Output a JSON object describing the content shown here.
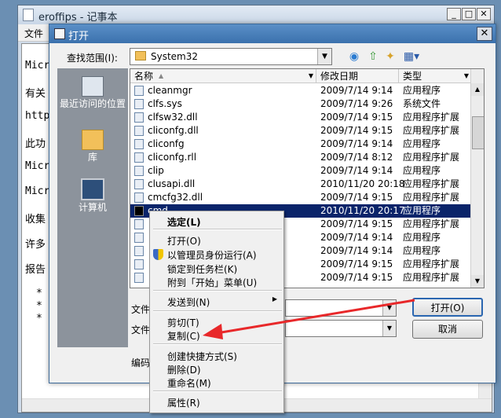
{
  "notepad": {
    "title": "eroffips - 记事本",
    "menu_file": "文件",
    "lines": [
      "Micr",
      "有关",
      "http",
      "此功",
      "Micr",
      "Micr",
      "收集",
      "许多",
      "报告",
      "*",
      "*",
      "*"
    ]
  },
  "dialog": {
    "title": "打开",
    "look_in_label": "查找范围(I):",
    "look_in_value": "System32",
    "places": [
      {
        "label": "最近访问的位置",
        "icon": "recent-places-icon"
      },
      {
        "label": "库",
        "icon": "libraries-icon"
      },
      {
        "label": "计算机",
        "icon": "computer-icon"
      }
    ],
    "columns": {
      "name": "名称",
      "date": "修改日期",
      "type": "类型"
    },
    "files": [
      {
        "name": "cleanmgr",
        "date": "2009/7/14 9:14",
        "type": "应用程序"
      },
      {
        "name": "clfs.sys",
        "date": "2009/7/14 9:26",
        "type": "系统文件"
      },
      {
        "name": "clfsw32.dll",
        "date": "2009/7/14 9:15",
        "type": "应用程序扩展"
      },
      {
        "name": "cliconfg.dll",
        "date": "2009/7/14 9:15",
        "type": "应用程序扩展"
      },
      {
        "name": "cliconfg",
        "date": "2009/7/14 9:14",
        "type": "应用程序"
      },
      {
        "name": "cliconfg.rll",
        "date": "2009/7/14 8:12",
        "type": "应用程序扩展"
      },
      {
        "name": "clip",
        "date": "2009/7/14 9:14",
        "type": "应用程序"
      },
      {
        "name": "clusapi.dll",
        "date": "2010/11/20 20:18",
        "type": "应用程序扩展"
      },
      {
        "name": "cmcfg32.dll",
        "date": "2009/7/14 9:15",
        "type": "应用程序扩展"
      },
      {
        "name": "cmd",
        "date": "2010/11/20 20:17",
        "type": "应用程序"
      },
      {
        "name": "",
        "date": "2009/7/14 9:15",
        "type": "应用程序扩展"
      },
      {
        "name": "",
        "date": "2009/7/14 9:14",
        "type": "应用程序"
      },
      {
        "name": "",
        "date": "2009/7/14 9:14",
        "type": "应用程序"
      },
      {
        "name": "",
        "date": "2009/7/14 9:15",
        "type": "应用程序扩展"
      },
      {
        "name": "",
        "date": "2009/7/14 9:15",
        "type": "应用程序扩展"
      }
    ],
    "filename_label": "文件",
    "filetype_label": "文件",
    "encoding_label": "编码",
    "open_button": "打开(O)",
    "cancel_button": "取消"
  },
  "context_menu": {
    "items": {
      "select": "选定(L)",
      "open": "打开(O)",
      "run_as_admin": "以管理员身份运行(A)",
      "pin_taskbar": "锁定到任务栏(K)",
      "pin_start": "附到「开始」菜单(U)",
      "send_to": "发送到(N)",
      "cut": "剪切(T)",
      "copy": "复制(C)",
      "create_shortcut": "创建快捷方式(S)",
      "delete": "删除(D)",
      "rename": "重命名(M)",
      "properties": "属性(R)"
    }
  },
  "colors": {
    "annotation_arrow": "#e8282a",
    "selection": "#0a246a",
    "dialog_title": "#3b71ad"
  }
}
